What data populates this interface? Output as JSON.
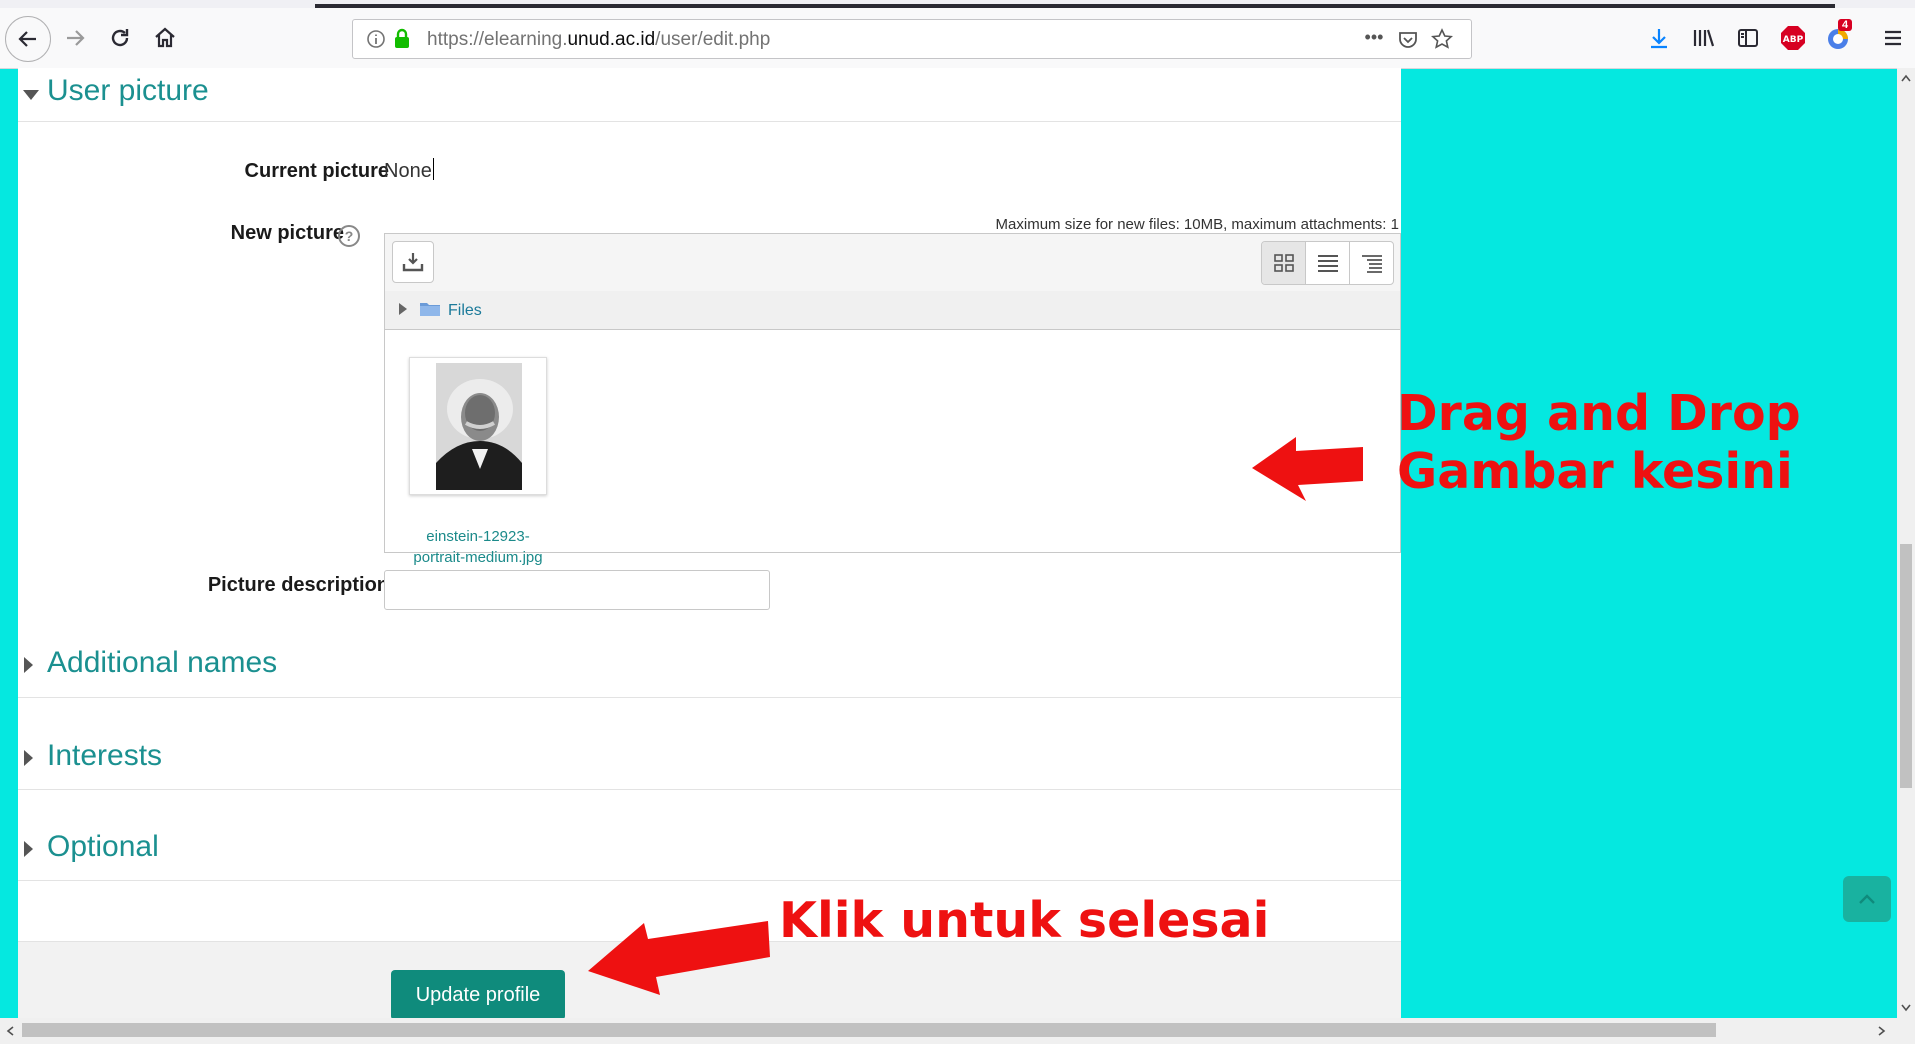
{
  "browser": {
    "url_prefix": "https://elearning.",
    "url_host": "unud.ac.id",
    "url_path": "/user/edit.php",
    "more_label": "•••",
    "abp_label": "ABP",
    "notification_count": "4"
  },
  "sections": {
    "user_picture": "User picture",
    "additional_names": "Additional names",
    "interests": "Interests",
    "optional": "Optional"
  },
  "form": {
    "current_picture_label": "Current picture",
    "current_picture_value": "None",
    "new_picture_label": "New picture",
    "help_symbol": "?",
    "max_size_note": "Maximum size for new files: 10MB, maximum attachments: 1",
    "files_label": "Files",
    "file_name_line1": "einstein-12923-",
    "file_name_line2": "portrait-medium.jpg",
    "picture_description_label": "Picture description",
    "picture_description_value": "",
    "update_button": "Update profile"
  },
  "annotations": {
    "drag_line1": "Drag and Drop",
    "drag_line2": "Gambar kesini",
    "klik": "Klik untuk selesai",
    "color": "#ee1111"
  },
  "colors": {
    "background": "#05e8e0",
    "accent": "#1b9090",
    "button": "#0f8b7c"
  }
}
